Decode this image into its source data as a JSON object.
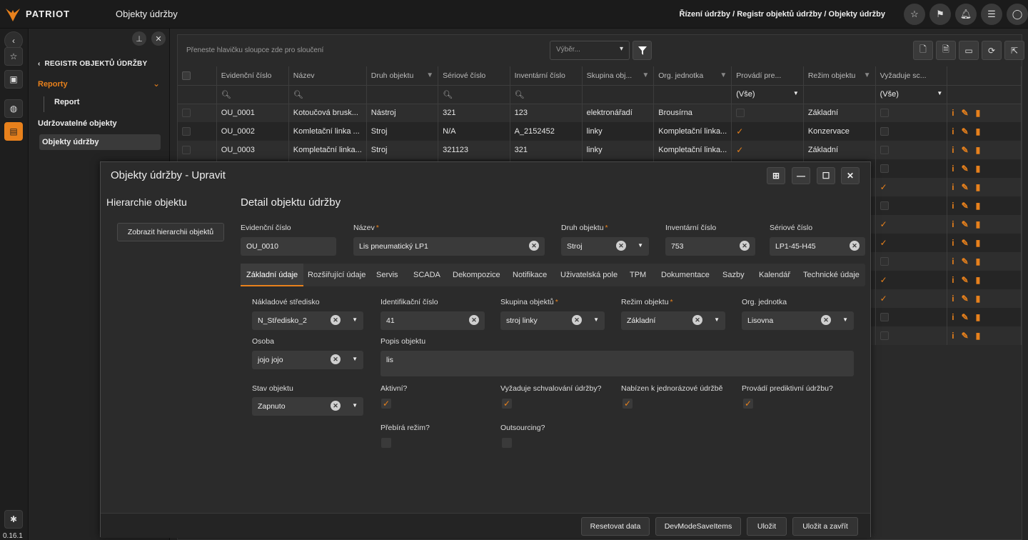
{
  "header": {
    "brand": "PATRIOT",
    "app_title": "Objekty údržby",
    "breadcrumb": "Řízení údržby / Registr objektů údržby / Objekty údržby"
  },
  "version": "0.16.1",
  "sidebar": {
    "back_label": "REGISTR OBJEKTŮ ÚDRŽBY",
    "group_label": "Reporty",
    "group_child": "Report",
    "items": [
      "Udržovatelné objekty",
      "Objekty údržby"
    ]
  },
  "grid": {
    "group_hint": "Přeneste hlavičku sloupce zde pro sloučení",
    "select_placeholder": "Výběr...",
    "columns": [
      "Evidenční číslo",
      "Název",
      "Druh objektu",
      "Sériové číslo",
      "Inventární číslo",
      "Skupina obj...",
      "Org. jednotka",
      "Provádí pre...",
      "Režim objektu",
      "Vyžaduje sc..."
    ],
    "filter_all": "(Vše)",
    "rows": [
      {
        "ev": "OU_0001",
        "name": "Kotoučová brusk...",
        "druh": "Nástroj",
        "ser": "321",
        "inv": "123",
        "sk": "elektronářadí",
        "org": "Brousírna",
        "prov": false,
        "rezim": "Základní",
        "vyz": false
      },
      {
        "ev": "OU_0002",
        "name": "Komletační linka ...",
        "druh": "Stroj",
        "ser": "N/A",
        "inv": "A_2152452",
        "sk": "linky",
        "org": "Kompletační linka...",
        "prov": true,
        "rezim": "Konzervace",
        "vyz": false
      },
      {
        "ev": "OU_0003",
        "name": "Kompletační linka...",
        "druh": "Stroj",
        "ser": "321123",
        "inv": "321",
        "sk": "linky",
        "org": "Kompletační linka...",
        "prov": true,
        "rezim": "Základní",
        "vyz": false
      }
    ],
    "extra_rows_vyz": [
      false,
      true,
      false,
      true,
      true,
      false,
      true,
      true,
      false,
      false
    ]
  },
  "modal": {
    "title": "Objekty údržby - Upravit",
    "hierarchy_title": "Hierarchie objektu",
    "hierarchy_button": "Zobrazit hierarchii objektů",
    "detail_title": "Detail objektu údržby",
    "fields": {
      "ev_label": "Evidenční číslo",
      "ev_value": "OU_0010",
      "nazev_label": "Název",
      "nazev_value": "Lis pneumatický LP1",
      "druh_label": "Druh objektu",
      "druh_value": "Stroj",
      "inv_label": "Inventární číslo",
      "inv_value": "753",
      "ser_label": "Sériové číslo",
      "ser_value": "LP1-45-H45"
    },
    "tabs": [
      "Základní údaje",
      "Rozšiřující údaje",
      "Servis",
      "SCADA",
      "Dekompozice",
      "Notifikace",
      "Uživatelská pole",
      "TPM",
      "Dokumentace",
      "Sazby",
      "Kalendář",
      "Technické údaje"
    ],
    "basic": {
      "ns_label": "Nákladové středisko",
      "ns_value": "N_Středisko_2",
      "id_label": "Identifikační číslo",
      "id_value": "41",
      "sk_label": "Skupina objektů",
      "sk_value": "stroj linky",
      "rz_label": "Režim objektu",
      "rz_value": "Základní",
      "org_label": "Org. jednotka",
      "org_value": "Lisovna",
      "os_label": "Osoba",
      "os_value": "jojo jojo",
      "popis_label": "Popis objektu",
      "popis_value": "lis",
      "stav_label": "Stav objektu",
      "stav_value": "Zapnuto",
      "aktivni_label": "Aktivní?",
      "aktivni": true,
      "schval_label": "Vyžaduje schvalování údržby?",
      "schval": true,
      "nabizen_label": "Nabízen k jednorázové údržbě",
      "nabizen": true,
      "predikt_label": "Provádí prediktivní údržbu?",
      "predikt": true,
      "prebira_label": "Přebírá režim?",
      "prebira": false,
      "outs_label": "Outsourcing?",
      "outs": false
    },
    "footer": [
      "Resetovat data",
      "DevModeSaveItems",
      "Uložit",
      "Uložit a zavřít"
    ]
  },
  "colors": {
    "accent": "#e8811c"
  }
}
